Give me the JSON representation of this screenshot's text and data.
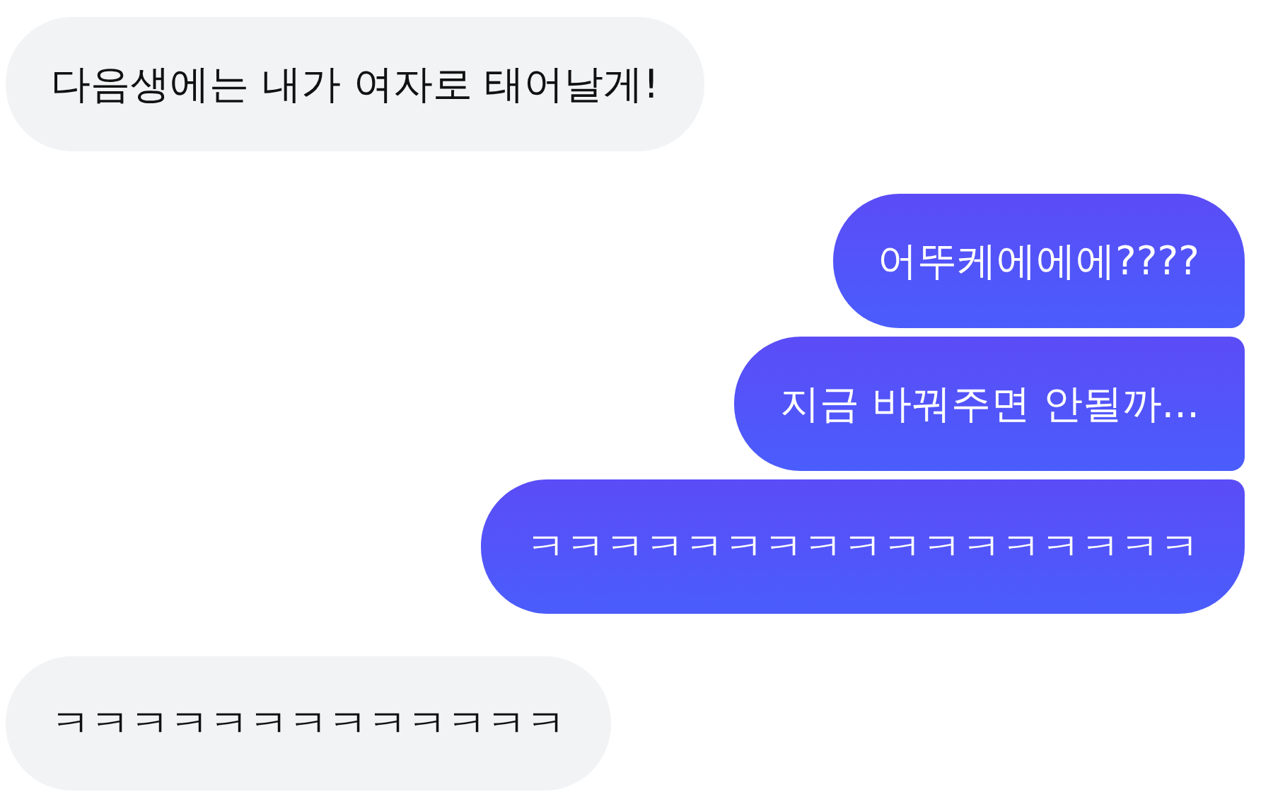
{
  "messages": [
    {
      "kind": "incoming",
      "text": "다음생에는 내가 여자로 태어날게!"
    },
    {
      "kind": "outgoing",
      "text": "어뚜케에에에????"
    },
    {
      "kind": "outgoing",
      "text": "지금 바꿔주면 안될까..."
    },
    {
      "kind": "outgoing",
      "text": "ㅋㅋㅋㅋㅋㅋㅋㅋㅋㅋㅋㅋㅋㅋㅋㅋㅋ"
    },
    {
      "kind": "incoming",
      "text": "ㅋㅋㅋㅋㅋㅋㅋㅋㅋㅋㅋㅋㅋ"
    }
  ]
}
